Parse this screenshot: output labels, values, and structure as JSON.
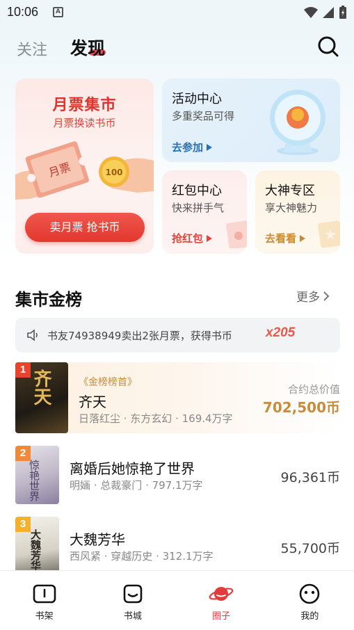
{
  "status": {
    "time": "10:06",
    "notif_letter": "A"
  },
  "header": {
    "tabs": [
      {
        "label": "关注"
      },
      {
        "label": "发现"
      }
    ]
  },
  "cards": {
    "ticket": {
      "title": "月票集市",
      "subtitle": "月票换读书币",
      "ticket_text": "月票",
      "coin_text": "100",
      "button": "卖月票 抢书币"
    },
    "activity": {
      "title": "活动中心",
      "subtitle": "多重奖品可得",
      "link": "去参加"
    },
    "redpacket": {
      "title": "红包中心",
      "subtitle": "快来拼手气",
      "link": "抢红包"
    },
    "master": {
      "title": "大神专区",
      "subtitle": "享大神魅力",
      "link": "去看看"
    }
  },
  "leaderboard": {
    "title": "集市金榜",
    "more": "更多",
    "notice": {
      "text": "书友74938949卖出2张月票，获得书币",
      "amount": "x205"
    },
    "items": [
      {
        "rank": "1",
        "badge": "《金榜榜首》",
        "name": "齐天",
        "meta": "日落红尘 · 东方玄幻 · 169.4万字",
        "value_label": "合约总价值",
        "value": "702,500币",
        "cover_text": "齐天"
      },
      {
        "rank": "2",
        "name": "离婚后她惊艳了世界",
        "meta": "明婳 · 总裁豪门 · 797.1万字",
        "value": "96,361币",
        "cover_text": "惊艳世界"
      },
      {
        "rank": "3",
        "name": "大魏芳华",
        "meta": "西风紧 · 穿越历史 · 312.1万字",
        "value": "55,700币",
        "cover_text": "大魏芳华"
      }
    ]
  },
  "bottom_nav": {
    "items": [
      {
        "label": "书架"
      },
      {
        "label": "书城"
      },
      {
        "label": "圈子"
      },
      {
        "label": "我的"
      }
    ],
    "active_color": "#e53a3a"
  }
}
